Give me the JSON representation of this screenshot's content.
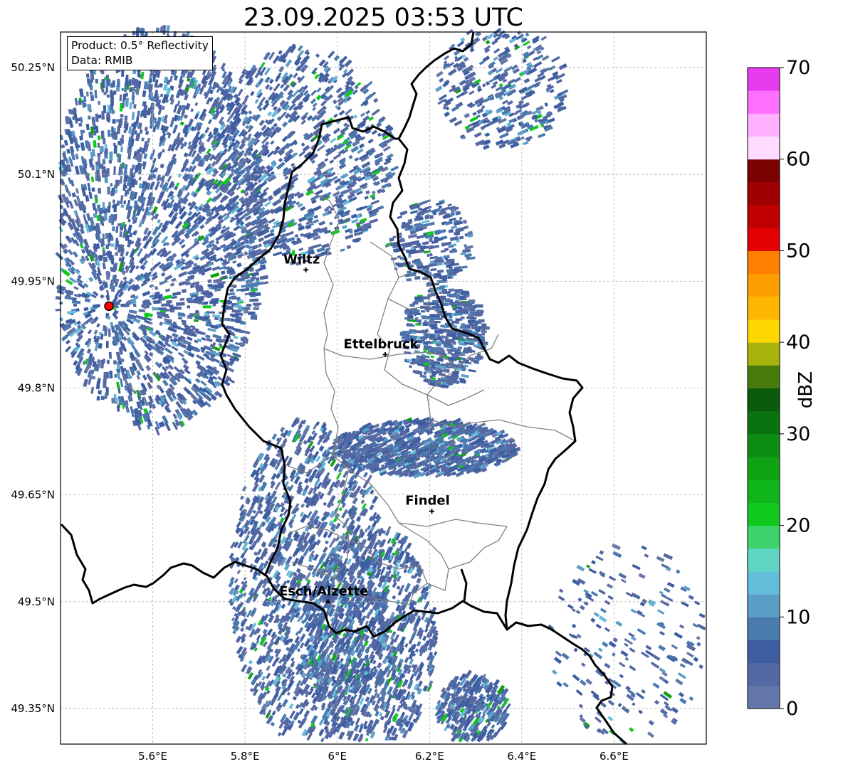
{
  "title": "23.09.2025 03:53 UTC",
  "info": {
    "product": "Product: 0.5° Reflectivity",
    "data": "Data: RMIB"
  },
  "map": {
    "x_ticks": [
      "5.6°E",
      "5.8°E",
      "6°E",
      "6.2°E",
      "6.4°E",
      "6.6°E"
    ],
    "y_ticks": [
      "50.25°N",
      "50.1°N",
      "49.95°N",
      "49.8°N",
      "49.65°N",
      "49.5°N",
      "49.35°N"
    ],
    "x_range": [
      5.4,
      6.8
    ],
    "y_range": [
      49.3,
      50.3
    ],
    "gridlines": true,
    "radar_site": {
      "lon": 5.505,
      "lat": 49.915
    },
    "cities": [
      {
        "name": "Wiltz",
        "lon": 5.932,
        "lat": 49.966
      },
      {
        "name": "Ettelbruck",
        "lon": 6.104,
        "lat": 49.847
      },
      {
        "name": "Findel",
        "lon": 6.205,
        "lat": 49.627
      },
      {
        "name": "Esch/Alzette",
        "lon": 5.98,
        "lat": 49.5
      }
    ]
  },
  "colorbar": {
    "label": "dBZ",
    "ticks": [
      "0",
      "10",
      "20",
      "30",
      "40",
      "50",
      "60",
      "70"
    ],
    "range": [
      0,
      70
    ],
    "step": 2.5,
    "colors": [
      "#6577a8",
      "#5468a3",
      "#3f5ea2",
      "#4a7ab0",
      "#5b9fc7",
      "#64bedb",
      "#5fd5c2",
      "#3ed36a",
      "#10c81e",
      "#0fb51a",
      "#0fa313",
      "#0d8c12",
      "#0b7210",
      "#095a0a",
      "#467a0b",
      "#aab30b",
      "#ffd700",
      "#ffb600",
      "#ff9e00",
      "#ff7f00",
      "#e20000",
      "#c00000",
      "#a00000",
      "#7b0000",
      "#ffdcff",
      "#ffb0ff",
      "#ff70ff",
      "#e83aee"
    ]
  },
  "colors": {
    "border": "#000000",
    "communes": "#808080",
    "grid": "#b0b0b0",
    "radar_site": "#ff0000"
  }
}
